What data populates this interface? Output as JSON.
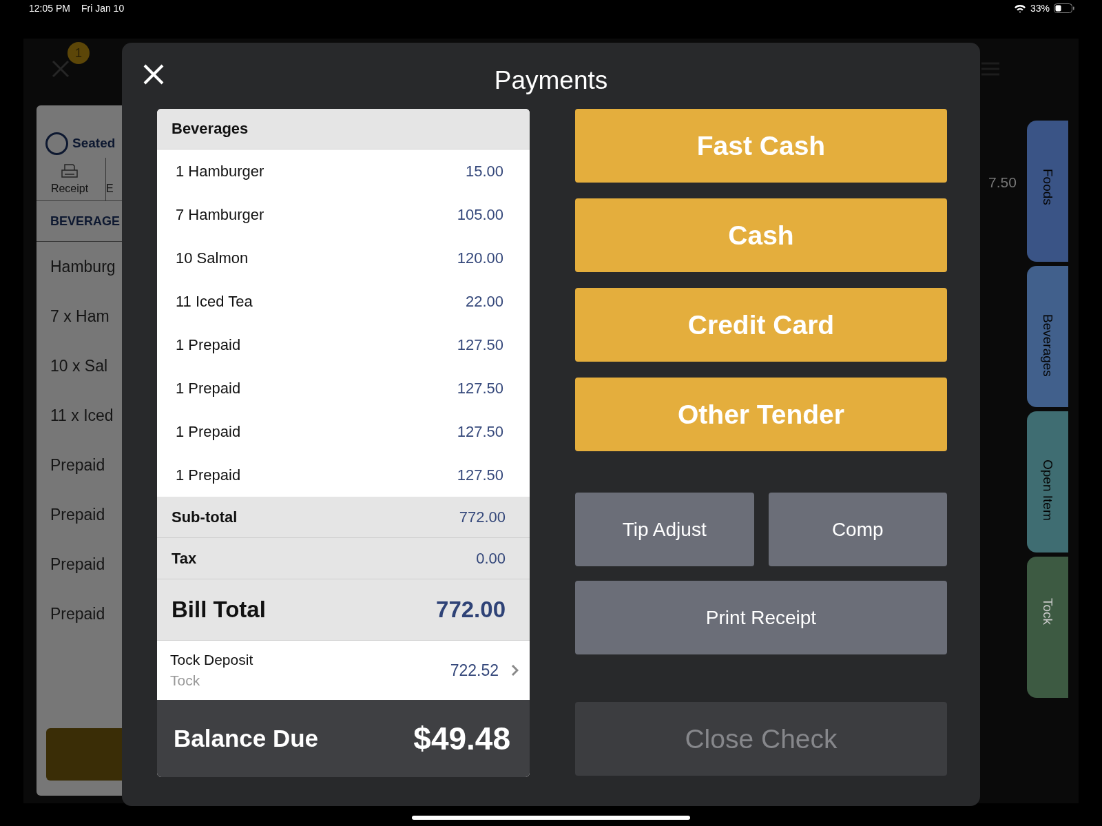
{
  "status_bar": {
    "time": "12:05 PM",
    "date": "Fri Jan 10",
    "battery": "33%"
  },
  "background": {
    "badge": "1",
    "order_card": {
      "status": "Seated",
      "actions": [
        "Receipt",
        "E"
      ],
      "section": "BEVERAGE",
      "items": [
        "Hamburg",
        "7 x Ham",
        "10 x Sal",
        "11 x Iced",
        "Prepaid",
        "Prepaid",
        "Prepaid",
        "Prepaid"
      ]
    },
    "amount": "7.50",
    "side_tabs": [
      {
        "label": "Foods",
        "color": "#3a5486"
      },
      {
        "label": "Beverages",
        "color": "#41608c"
      },
      {
        "label": "Open Item",
        "color": "#3f6d72"
      },
      {
        "label": "Tock",
        "color": "#3d5a42"
      }
    ]
  },
  "dialog": {
    "title": "Payments",
    "bill": {
      "section": "Beverages",
      "items": [
        {
          "name": "1 Hamburger",
          "amount": "15.00"
        },
        {
          "name": "7 Hamburger",
          "amount": "105.00"
        },
        {
          "name": "10 Salmon",
          "amount": "120.00"
        },
        {
          "name": "11 Iced Tea",
          "amount": "22.00"
        },
        {
          "name": "1 Prepaid",
          "amount": "127.50"
        },
        {
          "name": "1 Prepaid",
          "amount": "127.50"
        },
        {
          "name": "1 Prepaid",
          "amount": "127.50"
        },
        {
          "name": "1 Prepaid",
          "amount": "127.50"
        }
      ],
      "subtotals": [
        {
          "label": "Sub-total",
          "value": "772.00"
        },
        {
          "label": "Tax",
          "value": "0.00"
        }
      ],
      "total": {
        "label": "Bill Total",
        "value": "772.00"
      },
      "payments": [
        {
          "name": "Tock Deposit",
          "source": "Tock",
          "amount": "722.52"
        }
      ],
      "balance": {
        "label": "Balance Due",
        "value": "$49.48"
      }
    },
    "tender_buttons": [
      "Fast Cash",
      "Cash",
      "Credit Card",
      "Other Tender"
    ],
    "actions": [
      {
        "label": "Tip Adjust",
        "kind": "half"
      },
      {
        "label": "Comp",
        "kind": "half"
      },
      {
        "label": "Print Receipt",
        "kind": "wide"
      }
    ],
    "close_check": {
      "label": "Close Check",
      "disabled": true
    }
  }
}
